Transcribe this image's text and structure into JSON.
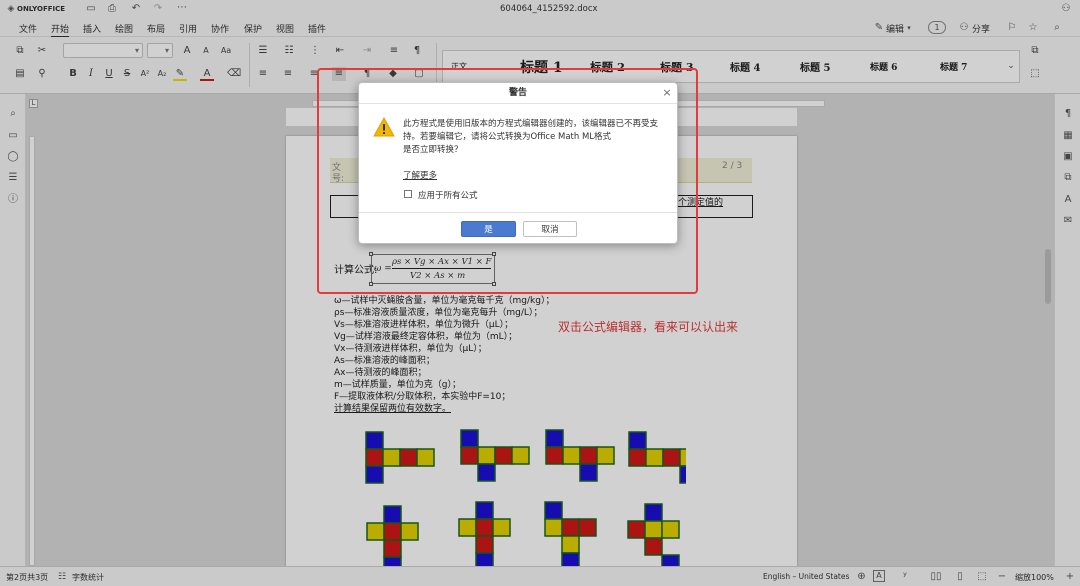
{
  "app": {
    "brand": "ONLYOFFICE",
    "file_name": "604064_4152592.docx"
  },
  "menu": {
    "tabs": [
      "文件",
      "开始",
      "插入",
      "绘图",
      "布局",
      "引用",
      "协作",
      "保护",
      "视图",
      "插件"
    ],
    "active": "开始"
  },
  "header_right": {
    "edit_label": "编辑",
    "share_label": "分享"
  },
  "styles": [
    "正文",
    "标题 1",
    "标题 2",
    "标题 3",
    "标题 4",
    "标题 5",
    "标题 6",
    "标题 7"
  ],
  "document": {
    "header_left_1": "文",
    "header_left_2": "号:",
    "page_counter": "2 / 3",
    "table_snippet": "个测定值的",
    "formula_label": "计算公式:",
    "formula_lhs": "ω =",
    "formula_num": "ρs × Vg × Ax × V1 × F",
    "formula_den": "V2 × As × m",
    "lines": [
      "ω—试样中灭蝇胺含量，单位为毫克每千克（mg/kg）；",
      "ρs—标准溶液质量浓度，单位为毫克每升（mg/L）；",
      "Vs—标准溶液进样体积，单位为微升（μL）；",
      "Vg—试样溶液最终定容体积，单位为（mL）；",
      "Vx—待测液进样体积，单位为（μL）；",
      "As—标准溶液的峰面积；",
      "Ax—待测液的峰面积；",
      "m—试样质量，单位为克（g）；",
      "F—提取液体积/分取体积，本实验中F=10；",
      "计算结果保留两位有效数字。"
    ],
    "annotation": "双击公式编辑器，看来可以认出来"
  },
  "dialog": {
    "title": "警告",
    "message_lines": [
      "此方程式是使用旧版本的方程式编辑器创建的，该编辑器已不再受支",
      "持。若要编辑它，请将公式转换为Office Math ML格式",
      "是否立即转换？"
    ],
    "learn_more": "了解更多",
    "apply_all_label": "应用于所有公式",
    "apply_all_checked": false,
    "yes_label": "是",
    "cancel_label": "取消"
  },
  "status": {
    "page_info": "第2页共3页",
    "word_count": "字数统计",
    "language": "English – United States",
    "zoom": "缩放100%"
  },
  "colors": {
    "accent": "#4a7bd0",
    "warning": "#f2b705",
    "annotation": "#e23b3b",
    "blue": "#1c0fd6",
    "red": "#d21818",
    "yellow": "#e3d200"
  }
}
